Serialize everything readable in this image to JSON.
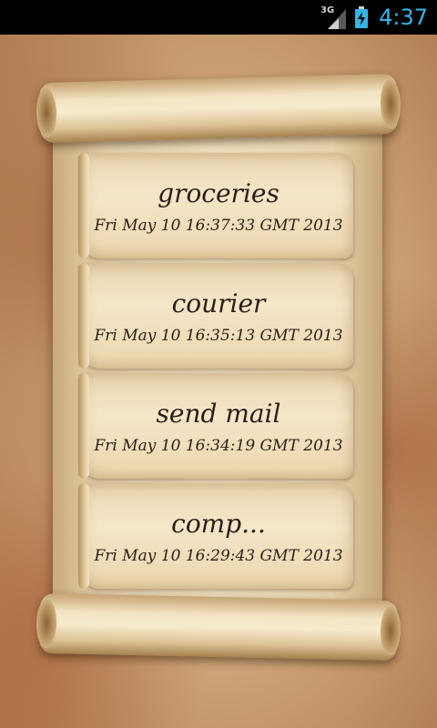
{
  "status_bar": {
    "network_label": "3G",
    "time": "4:37",
    "accent_color": "#33b5e5"
  },
  "notes": [
    {
      "title": "groceries",
      "date": "Fri May 10 16:37:33 GMT 2013"
    },
    {
      "title": "courier",
      "date": "Fri May 10 16:35:13 GMT 2013"
    },
    {
      "title": "send mail",
      "date": "Fri May 10 16:34:19 GMT 2013"
    },
    {
      "title": "comp...",
      "date": "Fri May 10 16:29:43 GMT 2013"
    }
  ]
}
